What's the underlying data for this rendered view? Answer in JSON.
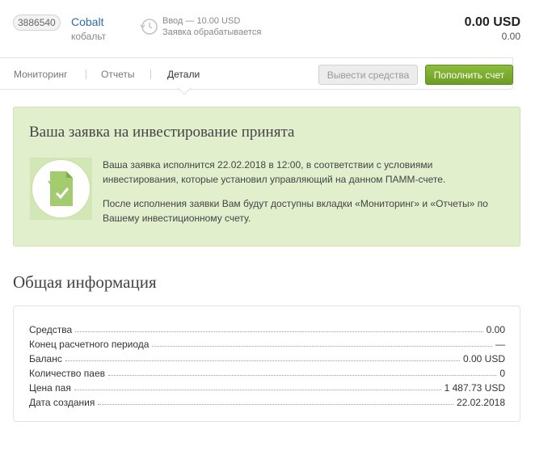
{
  "account": {
    "id": "3886540",
    "name": "Cobalt",
    "name_sub": "кобальт",
    "status_line1": "Ввод — 10.00 USD",
    "status_line2": "Заявка обрабатывается",
    "balance_main": "0.00 USD",
    "balance_sub": "0.00"
  },
  "nav": {
    "tabs": [
      {
        "label": "Мониторинг"
      },
      {
        "label": "Отчеты"
      },
      {
        "label": "Детали"
      }
    ],
    "active_tab": "Детали",
    "withdraw_label": "Вывести средства",
    "deposit_label": "Пополнить счет"
  },
  "notice": {
    "title": "Ваша заявка на инвестирование принята",
    "text1": "Ваша заявка исполнится 22.02.2018 в 12:00, в соответствии с условиями инвестирования, которые установил управляющий на данном ПАММ-счете.",
    "text2": "После исполнения заявки Вам будут доступны вкладки «Мониторинг» и «Отчеты» по Вашему инвестиционному счету.",
    "icon": "document-check-icon"
  },
  "general": {
    "title": "Общая информация",
    "rows": [
      {
        "label": "Средства",
        "value": "0.00"
      },
      {
        "label": "Конец расчетного периода",
        "value": "—"
      },
      {
        "label": "Баланс",
        "value": "0.00 USD"
      },
      {
        "label": "Количество паев",
        "value": "0"
      },
      {
        "label": "Цена пая",
        "value": "1 487.73 USD"
      },
      {
        "label": "Дата создания",
        "value": "22.02.2018"
      }
    ]
  },
  "colors": {
    "link": "#2a6fb5",
    "accent_green": "#7aab2c",
    "notice_bg": "#e1efcd"
  }
}
